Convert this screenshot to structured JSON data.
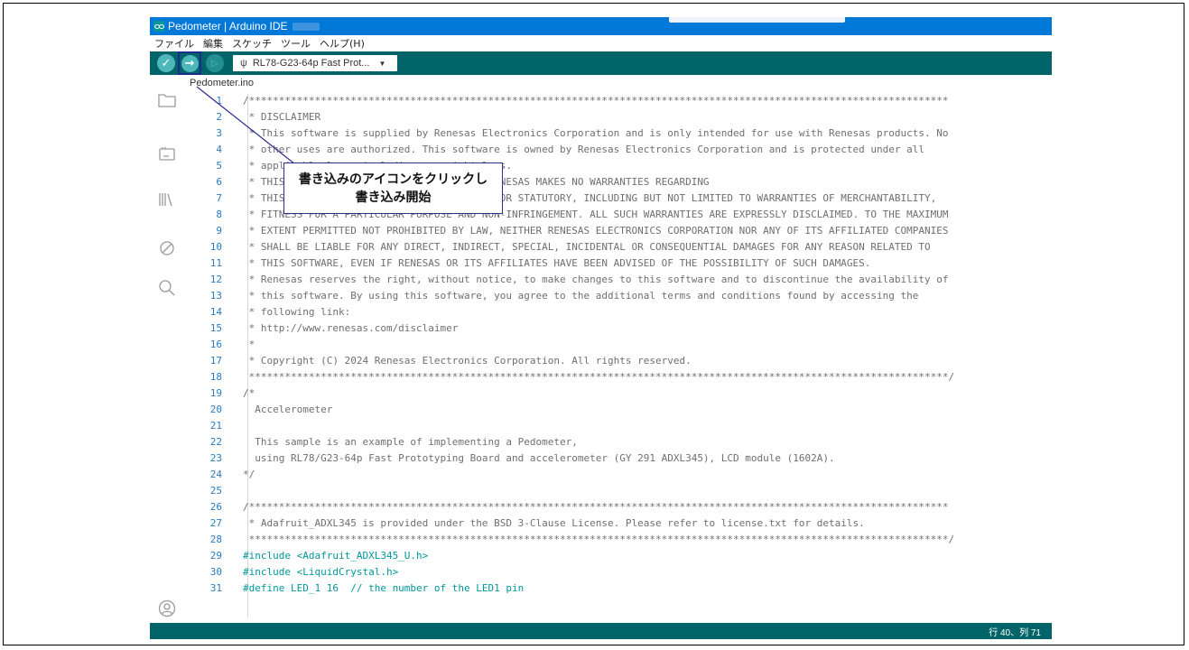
{
  "window": {
    "title": "Pedometer | Arduino IDE"
  },
  "menu": [
    "ファイル",
    "編集",
    "スケッチ",
    "ツール",
    "ヘルプ(H)"
  ],
  "toolbar": {
    "verify_glyph": "✓",
    "upload_glyph": "→",
    "debug_glyph": "▷",
    "board_label": "RL78-G23-64p Fast Prot...",
    "usb_glyph": "ψ",
    "caret_glyph": "▼"
  },
  "sidebar": {
    "icons": [
      "sketchbook-folder-icon",
      "boards-manager-icon",
      "library-manager-icon",
      "debug-icon",
      "search-icon",
      "account-icon"
    ]
  },
  "tab": {
    "filename": "Pedometer.ino"
  },
  "code": {
    "lines": [
      {
        "n": "1",
        "text": "/*********************************************************************************************************************"
      },
      {
        "n": "2",
        "text": " * DISCLAIMER"
      },
      {
        "n": "3",
        "text": " * This software is supplied by Renesas Electronics Corporation and is only intended for use with Renesas products. No"
      },
      {
        "n": "4",
        "text": " * other uses are authorized. This software is owned by Renesas Electronics Corporation and is protected under all"
      },
      {
        "n": "5",
        "text": " * applicable laws, including copyright laws."
      },
      {
        "n": "6",
        "text": " * THIS SOFTWARE IS PROVIDED \"AS IS\" AND RENESAS MAKES NO WARRANTIES REGARDING"
      },
      {
        "n": "7",
        "text": " * THIS SOFTWARE, WHETHER EXPRESS, IMPLIED OR STATUTORY, INCLUDING BUT NOT LIMITED TO WARRANTIES OF MERCHANTABILITY,"
      },
      {
        "n": "8",
        "text": " * FITNESS FOR A PARTICULAR PURPOSE AND NON-INFRINGEMENT. ALL SUCH WARRANTIES ARE EXPRESSLY DISCLAIMED. TO THE MAXIMUM"
      },
      {
        "n": "9",
        "text": " * EXTENT PERMITTED NOT PROHIBITED BY LAW, NEITHER RENESAS ELECTRONICS CORPORATION NOR ANY OF ITS AFFILIATED COMPANIES"
      },
      {
        "n": "10",
        "text": " * SHALL BE LIABLE FOR ANY DIRECT, INDIRECT, SPECIAL, INCIDENTAL OR CONSEQUENTIAL DAMAGES FOR ANY REASON RELATED TO"
      },
      {
        "n": "11",
        "text": " * THIS SOFTWARE, EVEN IF RENESAS OR ITS AFFILIATES HAVE BEEN ADVISED OF THE POSSIBILITY OF SUCH DAMAGES."
      },
      {
        "n": "12",
        "text": " * Renesas reserves the right, without notice, to make changes to this software and to discontinue the availability of"
      },
      {
        "n": "13",
        "text": " * this software. By using this software, you agree to the additional terms and conditions found by accessing the"
      },
      {
        "n": "14",
        "text": " * following link:"
      },
      {
        "n": "15",
        "text": " * http://www.renesas.com/disclaimer"
      },
      {
        "n": "16",
        "text": " *"
      },
      {
        "n": "17",
        "text": " * Copyright (C) 2024 Renesas Electronics Corporation. All rights reserved."
      },
      {
        "n": "18",
        "text": " *********************************************************************************************************************/"
      },
      {
        "n": "19",
        "text": "/*"
      },
      {
        "n": "20",
        "text": "  Accelerometer"
      },
      {
        "n": "21",
        "text": ""
      },
      {
        "n": "22",
        "text": "  This sample is an example of implementing a Pedometer,"
      },
      {
        "n": "23",
        "text": "  using RL78/G23-64p Fast Prototyping Board and accelerometer (GY 291 ADXL345), LCD module (1602A)."
      },
      {
        "n": "24",
        "text": "*/"
      },
      {
        "n": "25",
        "text": ""
      },
      {
        "n": "26",
        "text": "/*********************************************************************************************************************"
      },
      {
        "n": "27",
        "text": " * Adafruit_ADXL345 is provided under the BSD 3-Clause License. Please refer to license.txt for details."
      },
      {
        "n": "28",
        "text": " *********************************************************************************************************************/"
      },
      {
        "n": "29",
        "text": "#include <Adafruit_ADXL345_U.h>"
      },
      {
        "n": "30",
        "text": "#include <LiquidCrystal.h>"
      },
      {
        "n": "31",
        "text": "#define LED_1 16  // the number of the LED1 pin"
      }
    ]
  },
  "status": {
    "cursor": "行 40、列 71"
  },
  "callout": {
    "line1": "書き込みのアイコンをクリックし",
    "line2": "書き込み開始"
  },
  "colors": {
    "titlebar": "#0078d7",
    "toolbar": "#006468",
    "button": "#4db7bb",
    "line_numbers": "#2a7abf",
    "comment": "#6f6f6f",
    "directive": "#00979d",
    "callout_border": "#2b2f8f"
  }
}
